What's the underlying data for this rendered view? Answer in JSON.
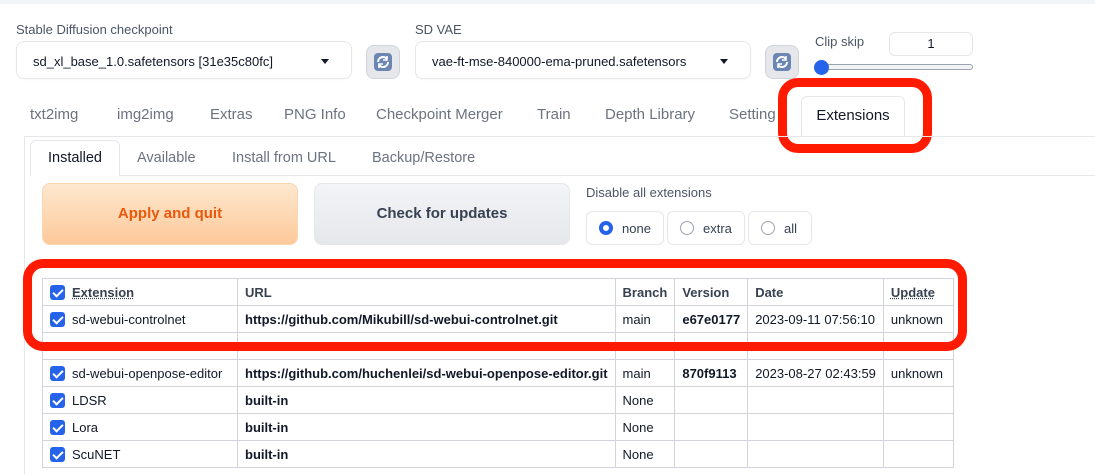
{
  "checkpoint": {
    "label": "Stable Diffusion checkpoint",
    "value": "sd_xl_base_1.0.safetensors [31e35c80fc]"
  },
  "vae": {
    "label": "SD VAE",
    "value": "vae-ft-mse-840000-ema-pruned.safetensors"
  },
  "clip_skip": {
    "label": "Clip skip",
    "value": "1",
    "slider_fraction": 0.0
  },
  "tabs": [
    "txt2img",
    "img2img",
    "Extras",
    "PNG Info",
    "Checkpoint Merger",
    "Train",
    "Depth Library",
    "Setting",
    "Extensions"
  ],
  "active_tab": "Extensions",
  "subtabs": [
    "Installed",
    "Available",
    "Install from URL",
    "Backup/Restore"
  ],
  "active_subtab": "Installed",
  "buttons": {
    "apply": "Apply and quit",
    "check": "Check for updates"
  },
  "disable": {
    "label": "Disable all extensions",
    "options": [
      "none",
      "extra",
      "all"
    ],
    "selected": "none"
  },
  "table": {
    "headers": [
      "Extension",
      "URL",
      "Branch",
      "Version",
      "Date",
      "Update"
    ],
    "rows": [
      {
        "name": "sd-webui-controlnet",
        "url": "https://github.com/Mikubill/sd-webui-controlnet.git",
        "branch": "main",
        "version": "e67e0177",
        "date": "2023-09-11 07:56:10",
        "update": "unknown"
      },
      {
        "name": "sd-webui-openpose-editor",
        "url": "https://github.com/huchenlei/sd-webui-openpose-editor.git",
        "branch": "main",
        "version": "870f9113",
        "date": "2023-08-27 02:43:59",
        "update": "unknown"
      },
      {
        "name": "LDSR",
        "url": "built-in",
        "branch": "None",
        "version": "",
        "date": "",
        "update": ""
      },
      {
        "name": "Lora",
        "url": "built-in",
        "branch": "None",
        "version": "",
        "date": "",
        "update": ""
      },
      {
        "name": "ScuNET",
        "url": "built-in",
        "branch": "None",
        "version": "",
        "date": "",
        "update": ""
      }
    ]
  },
  "colors": {
    "accent": "#2563eb",
    "highlight": "#ff1a00",
    "apply_text": "#ea580c"
  }
}
